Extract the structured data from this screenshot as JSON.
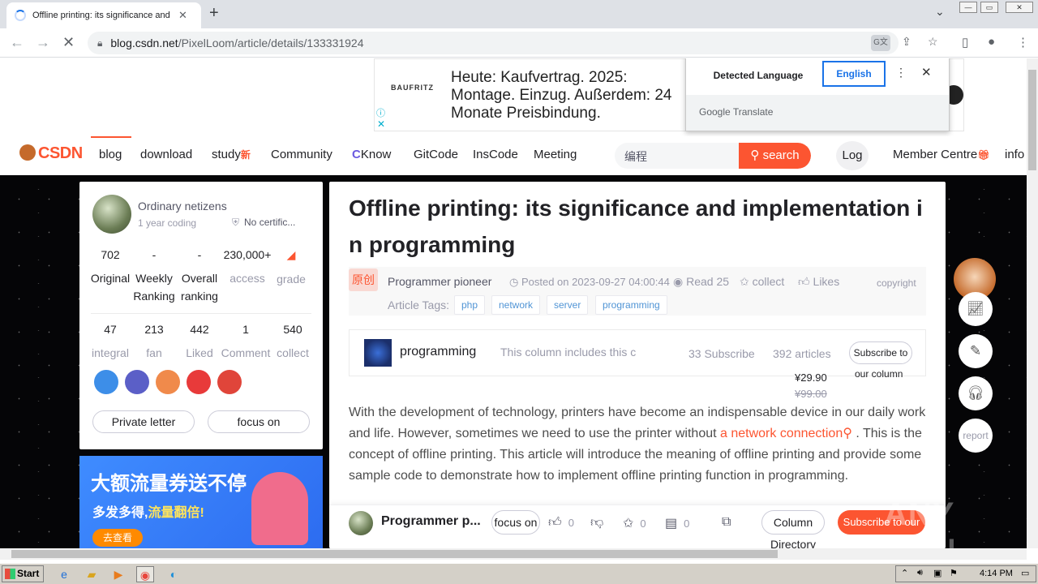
{
  "browser": {
    "tab_title": "Offline printing: its significance and im",
    "url_host": "blog.csdn.net",
    "url_path": "/PixelLoom/article/details/133331924"
  },
  "translate_popup": {
    "detected": "Detected Language",
    "english": "English",
    "footer": "Google Translate"
  },
  "ad": {
    "brand": "BAUFRITZ",
    "text": "Heute: Kaufvertrag. 2025: Montage. Einzug. Außerdem: 24 Monate Preisbindung."
  },
  "nav": {
    "logo": "CSDN",
    "items": [
      "blog",
      "download",
      "study",
      "Community",
      "Know",
      "GitCode",
      "InsCode",
      "Meeting"
    ],
    "study_badge": "新",
    "search_placeholder": "编程",
    "search_button": "search",
    "login": "Log",
    "member": "Member Centre",
    "info": "info"
  },
  "profile": {
    "name": "Ordinary netizens",
    "years": "1 year coding",
    "cert": "No certific...",
    "stats_row1": [
      {
        "value": "702",
        "label": "Original"
      },
      {
        "value": "-",
        "label": "Weekly Ranking"
      },
      {
        "value": "-",
        "label": "Overall ranking"
      },
      {
        "value": "230,000+",
        "label": "access"
      },
      {
        "value": "",
        "label": "grade"
      }
    ],
    "stats_row2": [
      {
        "value": "47",
        "label": "integral"
      },
      {
        "value": "213",
        "label": "fan"
      },
      {
        "value": "442",
        "label": "Liked"
      },
      {
        "value": "1",
        "label": "Comment"
      },
      {
        "value": "540",
        "label": "collect"
      }
    ],
    "private_letter": "Private letter",
    "focus_on": "focus on"
  },
  "left_banner": {
    "title": "大额流量券送不停",
    "sub_a": "多发多得,",
    "sub_b": "流量翻倍!",
    "button": "去查看"
  },
  "article": {
    "title": "Offline printing: its significance and implementation in programming",
    "original_tag": "原创",
    "author": "Programmer pioneer",
    "posted": "Posted on 2023-09-27 04:00:44",
    "read": "Read 25",
    "collect": "collect",
    "likes": "Likes",
    "copyright": "copyright",
    "tags_label": "Article Tags:",
    "tags": [
      "php",
      "network",
      "server",
      "programming"
    ],
    "column": {
      "name": "programming",
      "desc": "This column includes this c",
      "subscribe_count": "33 Subscribe",
      "articles": "392 articles",
      "subscribe_btn": "Subscribe to",
      "our_column": "our column",
      "price_now": "¥29.90",
      "price_old": "¥99.00"
    },
    "body_a": "With the development of technology, printers have become an indispensable device in our daily work and life. However, sometimes we need to use the printer without ",
    "body_kw": "a network connection",
    "body_b": " . This is the concept of offline printing. This article will introduce the meaning of offline printing and provide some sample code to demonstrate how to implement offline printing function in programming."
  },
  "footer": {
    "author": "Programmer p...",
    "focus_on": "focus on",
    "like_count": "0",
    "collect_count": "0",
    "comment_count": "0",
    "column_btn": "Column",
    "column_dir": "Directory",
    "subscribe": "Subscribe to our"
  },
  "side_tools": {
    "report": "report"
  },
  "watermark": "ANY RUN",
  "taskbar": {
    "start": "Start",
    "time": "4:14 PM"
  }
}
